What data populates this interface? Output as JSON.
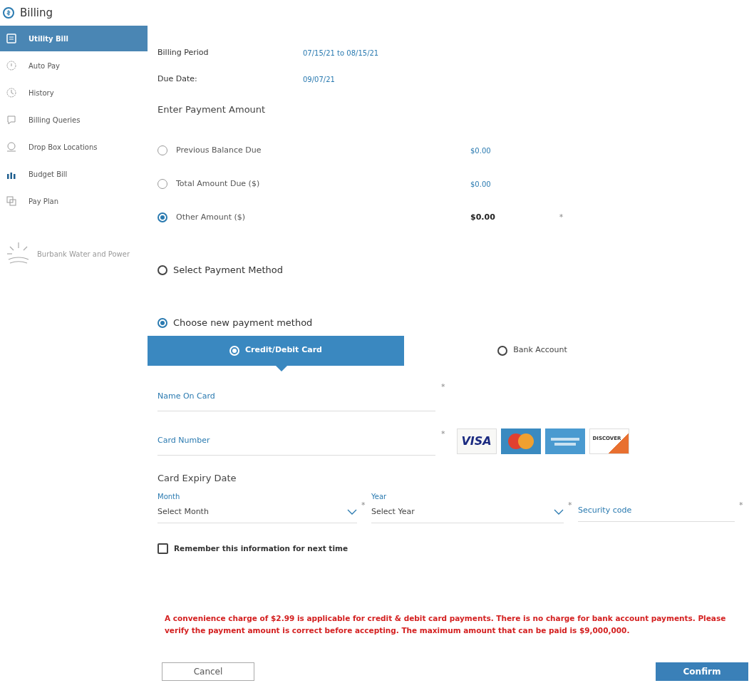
{
  "header": {
    "title": "Billing"
  },
  "sidebar": {
    "items": [
      {
        "label": "Utility Bill",
        "selected": true
      },
      {
        "label": "Auto Pay",
        "selected": false
      },
      {
        "label": "History",
        "selected": false
      },
      {
        "label": "Billing Queries",
        "selected": false
      },
      {
        "label": "Drop Box Locations",
        "selected": false
      },
      {
        "label": "Budget Bill",
        "selected": false
      },
      {
        "label": "Pay Plan",
        "selected": false
      }
    ],
    "brand": "Burbank Water and Power"
  },
  "details": [
    {
      "label": "Billing Period",
      "value": "07/15/21 to 08/15/21"
    },
    {
      "label": "Due Date:",
      "value": "09/07/21"
    }
  ],
  "amount_section": {
    "title": "Enter Payment Amount",
    "options": [
      {
        "label": "Previous Balance Due",
        "amount": "$0.00",
        "selected": false
      },
      {
        "label": "Total Amount Due ($)",
        "amount": "$0.00",
        "selected": false
      },
      {
        "label": "Other Amount ($)",
        "amount": "$0.00",
        "selected": true,
        "required_mark": "*"
      }
    ]
  },
  "select_payment_method": {
    "label": "Select Payment Method",
    "selected": false
  },
  "choose_new_method": {
    "label": "Choose new payment method",
    "selected": true
  },
  "method_tabs": [
    {
      "label": "Credit/Debit Card",
      "selected": true
    },
    {
      "label": "Bank Account",
      "selected": false
    }
  ],
  "name_on_card": {
    "placeholder": "Name On Card",
    "required_mark": "*"
  },
  "card_number": {
    "placeholder": "Card Number",
    "required_mark": "*"
  },
  "card_logos": [
    {
      "kind": "visa",
      "text": "VISA"
    },
    {
      "kind": "mastercard"
    },
    {
      "kind": "amex"
    },
    {
      "kind": "discover",
      "text": "DISCOVER"
    }
  ],
  "expiry": {
    "title": "Card Expiry Date",
    "month_label": "Month",
    "month_placeholder": "Select Month",
    "year_label": "Year",
    "year_placeholder": "Select Year",
    "security_placeholder": "Security code",
    "required_marks": [
      "*",
      "*",
      "*"
    ]
  },
  "remember": {
    "label": "Remember this information for next time",
    "checked": false
  },
  "notice": "A convenience charge of $2.99 is applicable for credit & debit card payments. There is no charge for bank account payments. Please verify the payment amount is correct before accepting. The maximum amount that can be paid is $9,000,000.",
  "buttons": [
    "Cancel",
    "Confirm"
  ]
}
